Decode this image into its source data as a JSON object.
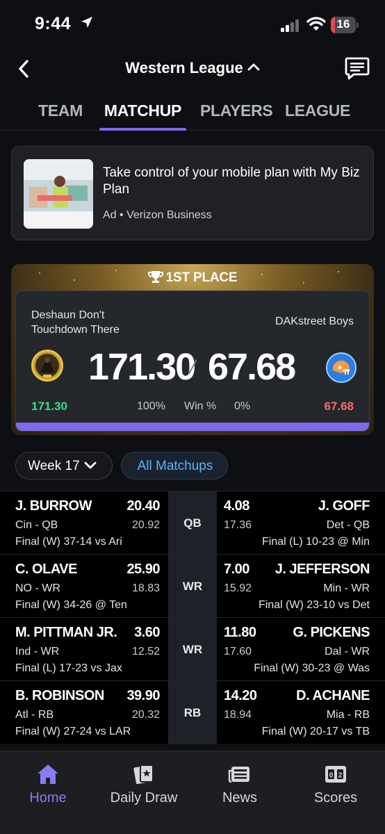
{
  "status_bar": {
    "time": "9:44",
    "battery": "16"
  },
  "header": {
    "title": "Western League"
  },
  "tabs": [
    {
      "label": "TEAM"
    },
    {
      "label": "MATCHUP"
    },
    {
      "label": "PLAYERS"
    },
    {
      "label": "LEAGUE"
    }
  ],
  "ad": {
    "headline": "Take control of your mobile plan with My Biz Plan",
    "sponsor": "Ad • Verizon Business"
  },
  "matchup": {
    "badge": "1ST PLACE",
    "left_team": "Deshaun Don't Touchdown There",
    "right_team": "DAKstreet Boys",
    "left_score": "171.30",
    "right_score": "67.68",
    "left_small": "171.30",
    "right_small": "67.68",
    "left_pct": "100%",
    "win_label": "Win %",
    "right_pct": "0%",
    "win_probability_left": 1.0,
    "left_color": "#3ddc84",
    "right_color": "#ff6b6b",
    "bar_color": "#7f6ae9"
  },
  "controls": {
    "week": "Week 17",
    "all_matchups": "All Matchups"
  },
  "players": [
    {
      "pos": "QB",
      "left": {
        "name": "J. BURROW",
        "pts": "20.40",
        "team": "Cin - QB",
        "proj": "20.92",
        "game": "Final (W) 37-14 vs Ari"
      },
      "right": {
        "name": "J. GOFF",
        "pts": "4.08",
        "team": "Det - QB",
        "proj": "17.36",
        "game": "Final (L) 10-23 @ Min"
      }
    },
    {
      "pos": "WR",
      "left": {
        "name": "C. OLAVE",
        "pts": "25.90",
        "team": "NO - WR",
        "proj": "18.83",
        "game": "Final (W) 34-26 @ Ten"
      },
      "right": {
        "name": "J. JEFFERSON",
        "pts": "7.00",
        "team": "Min - WR",
        "proj": "15.92",
        "game": "Final (W) 23-10 vs Det"
      }
    },
    {
      "pos": "WR",
      "left": {
        "name": "M. PITTMAN JR.",
        "pts": "3.60",
        "team": "Ind - WR",
        "proj": "12.52",
        "game": "Final (L) 17-23 vs Jax"
      },
      "right": {
        "name": "G. PICKENS",
        "pts": "11.80",
        "team": "Dal - WR",
        "proj": "17.60",
        "game": "Final (W) 30-23 @ Was"
      }
    },
    {
      "pos": "RB",
      "left": {
        "name": "B. ROBINSON",
        "pts": "39.90",
        "team": "Atl - RB",
        "proj": "20.32",
        "game": "Final (W) 27-24 vs LAR"
      },
      "right": {
        "name": "D. ACHANE",
        "pts": "14.20",
        "team": "Mia - RB",
        "proj": "18.94",
        "game": "Final (W) 20-17 vs TB"
      }
    }
  ],
  "bottom_nav": [
    {
      "label": "Home",
      "icon": "home-icon",
      "active": true
    },
    {
      "label": "Daily Draw",
      "icon": "cards-icon"
    },
    {
      "label": "News",
      "icon": "news-icon"
    },
    {
      "label": "Scores",
      "icon": "scoreboard-icon"
    }
  ],
  "colors": {
    "accent": "#7f6ae9",
    "link": "#57b6ff",
    "background": "#0e0f12"
  }
}
